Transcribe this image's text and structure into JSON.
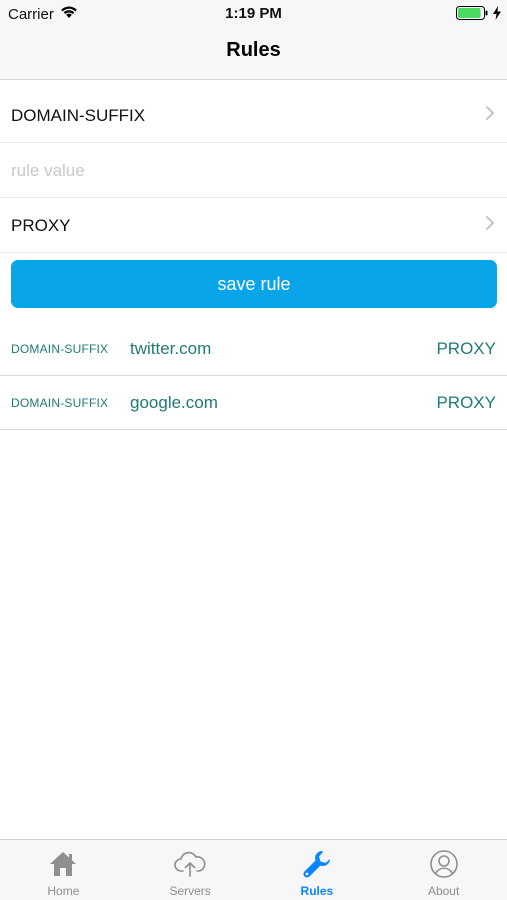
{
  "status_bar": {
    "carrier": "Carrier",
    "time": "1:19 PM",
    "battery_level": 0.9
  },
  "nav": {
    "title": "Rules"
  },
  "form": {
    "rule_type": "DOMAIN-SUFFIX",
    "rule_value_placeholder": "rule value",
    "rule_value": "",
    "policy": "PROXY",
    "save_label": "save rule"
  },
  "rules": [
    {
      "type": "DOMAIN-SUFFIX",
      "value": "twitter.com",
      "policy": "PROXY"
    },
    {
      "type": "DOMAIN-SUFFIX",
      "value": "google.com",
      "policy": "PROXY"
    }
  ],
  "tabs": [
    {
      "label": "Home",
      "icon": "home-icon"
    },
    {
      "label": "Servers",
      "icon": "cloud-upload-icon"
    },
    {
      "label": "Rules",
      "icon": "wrench-icon"
    },
    {
      "label": "About",
      "icon": "user-circle-icon"
    }
  ],
  "active_tab": "Rules",
  "colors": {
    "accent": "#0aa4e8",
    "tab_active": "#0a84ff",
    "rule_text": "#1f7a78",
    "battery": "#4cd964"
  }
}
